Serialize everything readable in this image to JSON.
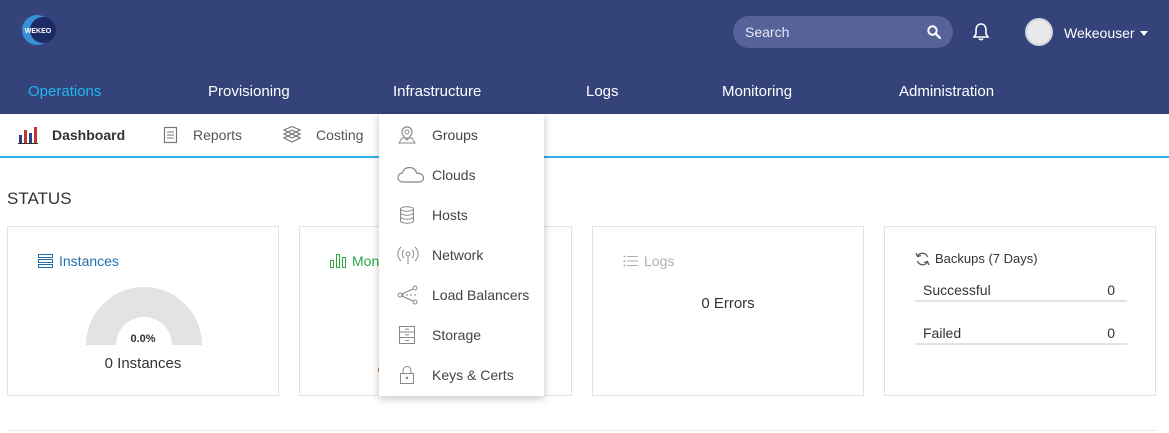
{
  "header": {
    "logo_text": "WEKEO",
    "search_placeholder": "Search",
    "username": "Wekeouser"
  },
  "nav": {
    "items": [
      {
        "label": "Operations",
        "active": true
      },
      {
        "label": "Provisioning"
      },
      {
        "label": "Infrastructure"
      },
      {
        "label": "Logs"
      },
      {
        "label": "Monitoring"
      },
      {
        "label": "Administration"
      }
    ]
  },
  "subnav": {
    "items": [
      {
        "label": "Dashboard",
        "active": true
      },
      {
        "label": "Reports"
      },
      {
        "label": "Costing"
      }
    ]
  },
  "status": {
    "title": "STATUS",
    "instances": {
      "title": "Instances",
      "percent": "0.0%",
      "count": "0 Instances"
    },
    "monitoring": {
      "title": "Mon"
    },
    "logs": {
      "title": "Logs",
      "errors": "0 Errors"
    },
    "backups": {
      "title": "Backups (7 Days)",
      "rows": [
        {
          "label": "Successful",
          "value": "0"
        },
        {
          "label": "Failed",
          "value": "0"
        }
      ]
    }
  },
  "dropdown": {
    "items": [
      {
        "label": "Groups",
        "icon": "map-pin-icon"
      },
      {
        "label": "Clouds",
        "icon": "cloud-icon"
      },
      {
        "label": "Hosts",
        "icon": "database-icon"
      },
      {
        "label": "Network",
        "icon": "broadcast-icon"
      },
      {
        "label": "Load Balancers",
        "icon": "share-icon"
      },
      {
        "label": "Storage",
        "icon": "storage-icon"
      },
      {
        "label": "Keys & Certs",
        "icon": "lock-icon"
      }
    ]
  },
  "colors": {
    "header_bg": "#34437a",
    "active_nav": "#20b6f0",
    "instances_title": "#1f6fae",
    "monitoring_title": "#27a745",
    "logs_title": "#aab0b8"
  }
}
